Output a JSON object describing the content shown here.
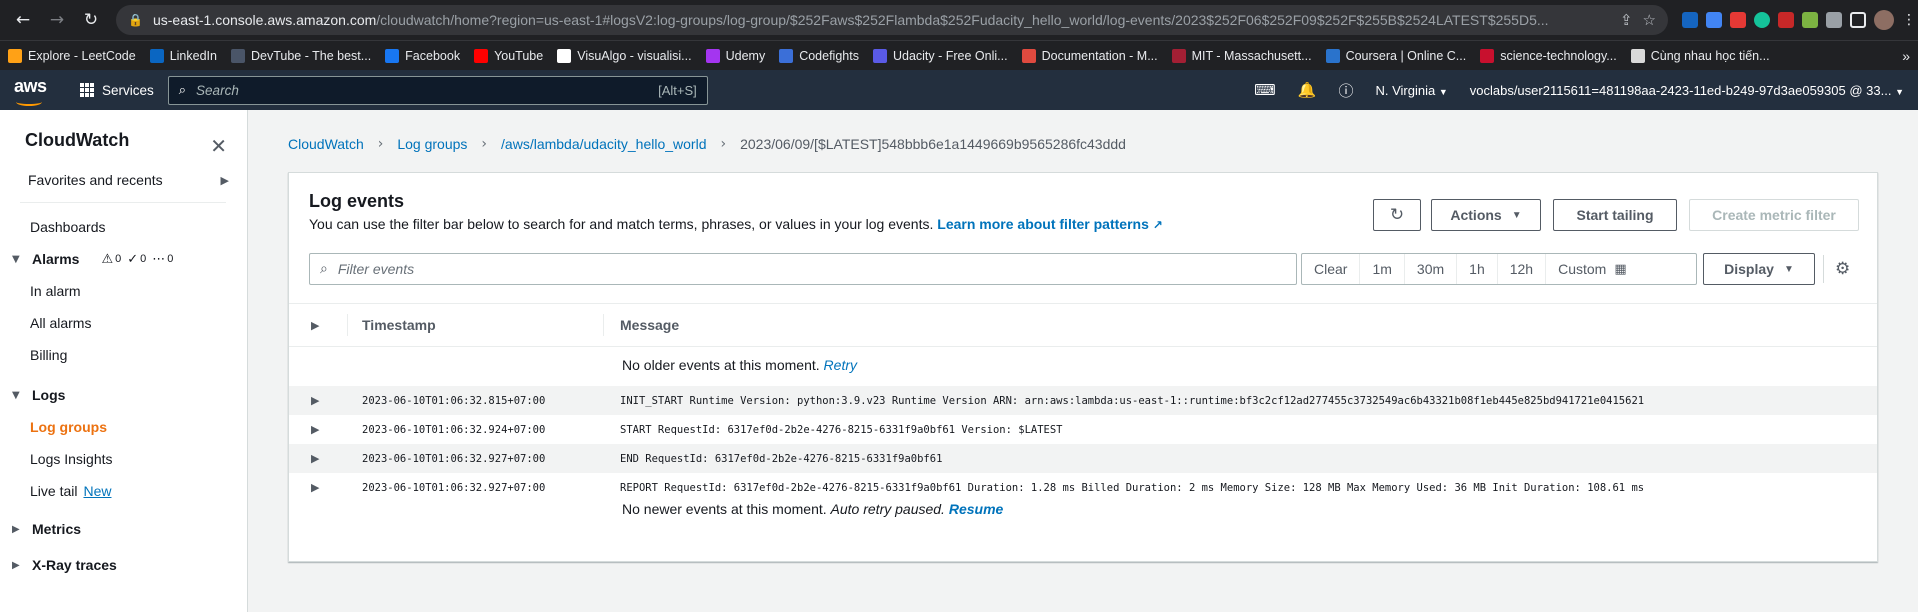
{
  "browser": {
    "url_host": "us-east-1.console.aws.amazon.com",
    "url_path": "/cloudwatch/home?region=us-east-1#logsV2:log-groups/log-group/$252Faws$252Flambda$252Fudacity_hello_world/log-events/2023$252F06$252F09$252F$255B$2524LATEST$255D5..."
  },
  "bookmarks": [
    {
      "label": "Explore - LeetCode",
      "color": "#ffa116"
    },
    {
      "label": "LinkedIn",
      "color": "#0a66c2"
    },
    {
      "label": "DevTube - The best...",
      "color": "#4a5568"
    },
    {
      "label": "Facebook",
      "color": "#1877f2"
    },
    {
      "label": "YouTube",
      "color": "#ff0000"
    },
    {
      "label": "VisuAlgo - visualisi...",
      "color": "#ffffff"
    },
    {
      "label": "Udemy",
      "color": "#a435f0"
    },
    {
      "label": "Codefights",
      "color": "#3b6fd8"
    },
    {
      "label": "Udacity - Free Onli...",
      "color": "#5a5ae6"
    },
    {
      "label": "Documentation - M...",
      "color": "#e04a3f"
    },
    {
      "label": "MIT - Massachusett...",
      "color": "#a31f34"
    },
    {
      "label": "Coursera | Online C...",
      "color": "#2a73cc"
    },
    {
      "label": "science-technology...",
      "color": "#c8102e"
    },
    {
      "label": "Cùng nhau học tiến...",
      "color": "#d9d9d9"
    }
  ],
  "aws": {
    "services": "Services",
    "search_placeholder": "Search",
    "search_shortcut": "[Alt+S]",
    "region": "N. Virginia",
    "account": "voclabs/user2115611=481198aa-2423-11ed-b249-97d3ae059305 @ 33..."
  },
  "sidebar": {
    "title": "CloudWatch",
    "favorites": "Favorites and recents",
    "dashboards": "Dashboards",
    "alarms": {
      "label": "Alarms",
      "alarm_count": "0",
      "ok_count": "0",
      "insufficient_count": "0"
    },
    "alarm_items": [
      "In alarm",
      "All alarms",
      "Billing"
    ],
    "logs": "Logs",
    "log_items": [
      "Log groups",
      "Logs Insights",
      "Live tail"
    ],
    "live_tail_badge": "New",
    "metrics": "Metrics",
    "xray": "X-Ray traces"
  },
  "breadcrumb": [
    "CloudWatch",
    "Log groups",
    "/aws/lambda/udacity_hello_world",
    "2023/06/09/[$LATEST]548bbb6e1a1449669b9565286fc43ddd"
  ],
  "panel": {
    "title": "Log events",
    "description": "You can use the filter bar below to search for and match terms, phrases, or values in your log events.",
    "learn_more": "Learn more about filter patterns",
    "actions": "Actions",
    "start_tailing": "Start tailing",
    "create_metric_filter": "Create metric filter",
    "filter_placeholder": "Filter events",
    "ranges": [
      "Clear",
      "1m",
      "30m",
      "1h",
      "12h",
      "Custom"
    ],
    "display": "Display"
  },
  "table": {
    "col_timestamp": "Timestamp",
    "col_message": "Message",
    "no_older": "No older events at this moment.",
    "retry": "Retry",
    "no_newer": "No newer events at this moment.",
    "auto_retry": "Auto retry paused.",
    "resume": "Resume",
    "rows": [
      {
        "ts": "2023-06-10T01:06:32.815+07:00",
        "msg": "INIT_START Runtime Version: python:3.9.v23 Runtime Version ARN: arn:aws:lambda:us-east-1::runtime:bf3c2cf12ad277455c3732549ac6b43321b08f1eb445e825bd941721e0415621"
      },
      {
        "ts": "2023-06-10T01:06:32.924+07:00",
        "msg": "START RequestId: 6317ef0d-2b2e-4276-8215-6331f9a0bf61 Version: $LATEST"
      },
      {
        "ts": "2023-06-10T01:06:32.927+07:00",
        "msg": "END RequestId: 6317ef0d-2b2e-4276-8215-6331f9a0bf61"
      },
      {
        "ts": "2023-06-10T01:06:32.927+07:00",
        "msg": "REPORT RequestId: 6317ef0d-2b2e-4276-8215-6331f9a0bf61 Duration: 1.28 ms Billed Duration: 2 ms Memory Size: 128 MB Max Memory Used: 36 MB Init Duration: 108.61 ms"
      }
    ]
  }
}
